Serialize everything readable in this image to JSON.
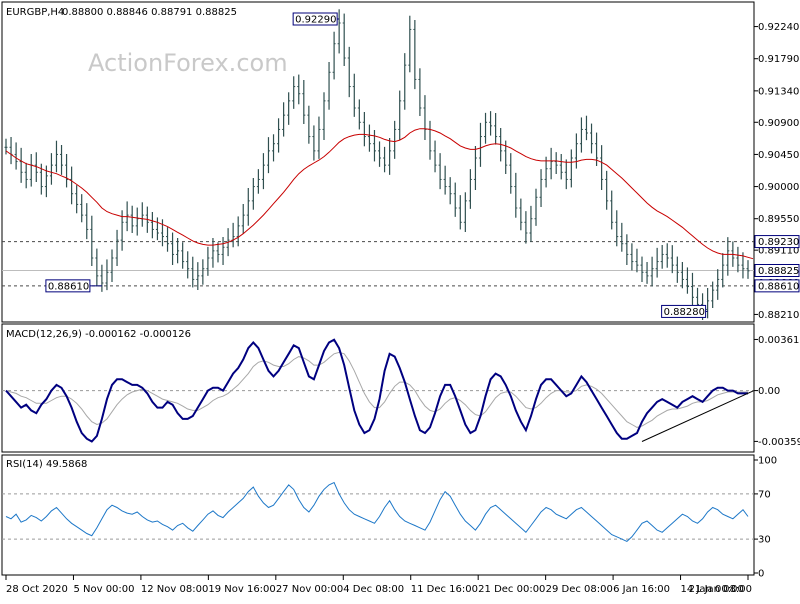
{
  "header": {
    "symbol": "EURGBP,H4",
    "ohlc": "0.88800 0.88846 0.88791 0.88825",
    "watermark": "ActionForex.com"
  },
  "colors": {
    "background": "#ffffff",
    "candles": "#2f4f4f",
    "ma": "#c80000",
    "macd": "#000080",
    "signal": "#a8a8a8",
    "rsi": "#1e78c8",
    "grid": "#6e6e6e",
    "label_box": "#00007a"
  },
  "chart_data": [
    {
      "type": "line",
      "title": "EURGBP,H4",
      "yaxis_ticks": [
        0.9224,
        0.9179,
        0.9134,
        0.909,
        0.9045,
        0.9,
        0.8955,
        0.8911,
        0.8866,
        0.8821
      ],
      "ylim": [
        0.8816,
        0.925
      ],
      "x_dates": [
        "28 Oct 2020",
        "5 Nov 00:00",
        "12 Nov 08:00",
        "19 Nov 16:00",
        "27 Nov 00:00",
        "4 Dec 08:00",
        "11 Dec 16:00",
        "21 Dec 00:00",
        "29 Dec 08:00",
        "6 Jan 16:00",
        "14 Jan 00:00",
        "21 Jan 08:00"
      ],
      "series": [
        {
          "kind": "price",
          "values": [
            0.9055,
            0.9045,
            0.9035,
            0.902,
            0.901,
            0.903,
            0.902,
            0.9,
            0.9015,
            0.903,
            0.9045,
            0.903,
            0.901,
            0.899,
            0.8975,
            0.896,
            0.894,
            0.89,
            0.8875,
            0.8865,
            0.888,
            0.89,
            0.8925,
            0.895,
            0.896,
            0.8945,
            0.8955,
            0.896,
            0.895,
            0.894,
            0.8935,
            0.893,
            0.892,
            0.8905,
            0.891,
            0.8895,
            0.8885,
            0.887,
            0.8875,
            0.8885,
            0.89,
            0.891,
            0.8905,
            0.8915,
            0.8925,
            0.893,
            0.8945,
            0.896,
            0.898,
            0.9,
            0.901,
            0.903,
            0.905,
            0.906,
            0.908,
            0.91,
            0.912,
            0.914,
            0.913,
            0.91,
            0.907,
            0.905,
            0.908,
            0.912,
            0.916,
            0.92,
            0.9229,
            0.918,
            0.914,
            0.911,
            0.909,
            0.907,
            0.906,
            0.905,
            0.904,
            0.903,
            0.905,
            0.908,
            0.912,
            0.917,
            0.922,
            0.915,
            0.911,
            0.908,
            0.905,
            0.903,
            0.901,
            0.9,
            0.899,
            0.897,
            0.895,
            0.898,
            0.901,
            0.904,
            0.907,
            0.909,
            0.9085,
            0.907,
            0.905,
            0.903,
            0.9,
            0.897,
            0.895,
            0.8935,
            0.8955,
            0.8985,
            0.901,
            0.9025,
            0.9035,
            0.903,
            0.902,
            0.901,
            0.904,
            0.906,
            0.908,
            0.9075,
            0.906,
            0.904,
            0.901,
            0.898,
            0.895,
            0.893,
            0.892,
            0.8905,
            0.8895,
            0.889,
            0.888,
            0.8875,
            0.8885,
            0.8895,
            0.8905,
            0.89,
            0.889,
            0.888,
            0.887,
            0.886,
            0.8845,
            0.8835,
            0.8828,
            0.884,
            0.8855,
            0.887,
            0.889,
            0.891,
            0.89,
            0.889,
            0.8885,
            0.8882
          ],
          "ma": [
            0.905,
            0.9045,
            0.904,
            0.9036,
            0.9032,
            0.903,
            0.9028,
            0.9025,
            0.9022,
            0.902,
            0.9018,
            0.9015,
            0.9012,
            0.9008,
            0.9003,
            0.8998,
            0.8992,
            0.8985,
            0.8978,
            0.897,
            0.8965,
            0.8962,
            0.896,
            0.8958,
            0.8958,
            0.8957,
            0.8956,
            0.8955,
            0.8954,
            0.8952,
            0.895,
            0.8947,
            0.8944,
            0.894,
            0.8936,
            0.8932,
            0.8928,
            0.8924,
            0.8921,
            0.8919,
            0.8918,
            0.8918,
            0.8919,
            0.892,
            0.8922,
            0.8925,
            0.8929,
            0.8934,
            0.894,
            0.8946,
            0.8953,
            0.896,
            0.8968,
            0.8976,
            0.8984,
            0.8992,
            0.9001,
            0.901,
            0.9018,
            0.9024,
            0.9029,
            0.9033,
            0.9037,
            0.9042,
            0.9048,
            0.9055,
            0.9062,
            0.9067,
            0.907,
            0.9072,
            0.9073,
            0.9073,
            0.9072,
            0.9071,
            0.9069,
            0.9066,
            0.9064,
            0.9063,
            0.9065,
            0.9069,
            0.9075,
            0.9079,
            0.9081,
            0.9081,
            0.908,
            0.9078,
            0.9075,
            0.9071,
            0.9067,
            0.9062,
            0.9057,
            0.9054,
            0.9052,
            0.9052,
            0.9054,
            0.9057,
            0.9059,
            0.906,
            0.9059,
            0.9057,
            0.9054,
            0.905,
            0.9046,
            0.9042,
            0.9039,
            0.9037,
            0.9036,
            0.9036,
            0.9036,
            0.9036,
            0.9035,
            0.9034,
            0.9034,
            0.9035,
            0.9037,
            0.9038,
            0.9038,
            0.9037,
            0.9034,
            0.903,
            0.9024,
            0.9018,
            0.9012,
            0.9005,
            0.8998,
            0.8991,
            0.8984,
            0.8977,
            0.8971,
            0.8966,
            0.8962,
            0.8958,
            0.8953,
            0.8948,
            0.8943,
            0.8937,
            0.8931,
            0.8925,
            0.8919,
            0.8914,
            0.891,
            0.8907,
            0.8905,
            0.8905,
            0.8905,
            0.8904,
            0.8903,
            0.8901,
            0.8899
          ]
        }
      ],
      "levels": [
        {
          "label": "0.89230",
          "value": 0.8923,
          "style": "dashed"
        },
        {
          "label": "0.88610",
          "value": 0.8861,
          "style": "dashed"
        },
        {
          "label": "0.88825",
          "value": 0.88825,
          "style": "solid"
        }
      ],
      "annotations": [
        {
          "text": "0.92290",
          "value": 0.9229
        },
        {
          "text": "0.88610",
          "value": 0.8861
        },
        {
          "text": "0.88280",
          "value": 0.8828
        }
      ]
    },
    {
      "type": "line",
      "title": "MACD(12,26,9) -0.000162 -0.000126",
      "yaxis_ticks": [
        "0.003615",
        "0.00",
        "-0.003592"
      ],
      "ylim": [
        -0.0042,
        0.004
      ],
      "series": [
        {
          "name": "MACD",
          "values": [
            0.0,
            -0.0004,
            -0.0008,
            -0.0012,
            -0.001,
            -0.0014,
            -0.0016,
            -0.001,
            -0.0006,
            0.0,
            0.0004,
            0.0002,
            -0.0004,
            -0.0012,
            -0.0022,
            -0.003,
            -0.0034,
            -0.0036,
            -0.0032,
            -0.002,
            -0.0006,
            0.0004,
            0.0008,
            0.0008,
            0.0006,
            0.0004,
            0.0004,
            0.0002,
            -0.0002,
            -0.0008,
            -0.0012,
            -0.0012,
            -0.0008,
            -0.001,
            -0.0016,
            -0.002,
            -0.002,
            -0.0018,
            -0.0012,
            -0.0006,
            0.0,
            0.0002,
            0.0002,
            0.0,
            0.0006,
            0.0012,
            0.0016,
            0.0022,
            0.003,
            0.0034,
            0.003,
            0.0022,
            0.0014,
            0.001,
            0.0014,
            0.002,
            0.0026,
            0.0032,
            0.003,
            0.002,
            0.001,
            0.0008,
            0.0018,
            0.0028,
            0.0034,
            0.0036,
            0.003,
            0.0018,
            0.0002,
            -0.0014,
            -0.0024,
            -0.003,
            -0.0028,
            -0.002,
            -0.0006,
            0.0014,
            0.0026,
            0.0024,
            0.0016,
            0.0006,
            -0.0006,
            -0.0018,
            -0.0028,
            -0.003,
            -0.0026,
            -0.0016,
            -0.0004,
            0.0004,
            0.0004,
            -0.0004,
            -0.0014,
            -0.0024,
            -0.003,
            -0.0028,
            -0.0018,
            -0.0004,
            0.0008,
            0.0012,
            0.001,
            0.0004,
            -0.0004,
            -0.0014,
            -0.0022,
            -0.0028,
            -0.0018,
            -0.0006,
            0.0004,
            0.0008,
            0.0008,
            0.0004,
            0.0,
            -0.0004,
            -0.0002,
            0.0004,
            0.001,
            0.0006,
            0.0,
            -0.0006,
            -0.0012,
            -0.0018,
            -0.0024,
            -0.003,
            -0.0034,
            -0.0034,
            -0.0032,
            -0.003,
            -0.0022,
            -0.0016,
            -0.0012,
            -0.0008,
            -0.0006,
            -0.0008,
            -0.001,
            -0.0012,
            -0.0008,
            -0.0006,
            -0.0004,
            -0.0006,
            -0.0008,
            -0.0004,
            0.0,
            0.0002,
            0.0002,
            0.0,
            0.0,
            -0.0002,
            -0.0002,
            -0.0002
          ]
        },
        {
          "name": "Signal",
          "values": [
            0.0,
            -0.0001,
            -0.0002,
            -0.0004,
            -0.0005,
            -0.0007,
            -0.0009,
            -0.0009,
            -0.0009,
            -0.0007,
            -0.0005,
            -0.0004,
            -0.0004,
            -0.0006,
            -0.0009,
            -0.0013,
            -0.0018,
            -0.0022,
            -0.0024,
            -0.0023,
            -0.002,
            -0.0015,
            -0.001,
            -0.0006,
            -0.0003,
            -0.0001,
            0.0,
            0.0001,
            0.0,
            -0.0002,
            -0.0004,
            -0.0006,
            -0.0007,
            -0.0008,
            -0.0009,
            -0.0011,
            -0.0013,
            -0.0014,
            -0.0014,
            -0.0012,
            -0.001,
            -0.0007,
            -0.0005,
            -0.0004,
            -0.0002,
            0.0001,
            0.0004,
            0.0008,
            0.0012,
            0.0017,
            0.002,
            0.0021,
            0.002,
            0.0018,
            0.0017,
            0.0017,
            0.0019,
            0.0022,
            0.0024,
            0.0023,
            0.0021,
            0.0018,
            0.0018,
            0.002,
            0.0023,
            0.0026,
            0.0027,
            0.0026,
            0.0021,
            0.0014,
            0.0006,
            -0.0002,
            -0.0008,
            -0.0012,
            -0.0012,
            -0.0008,
            -0.0002,
            0.0003,
            0.0006,
            0.0006,
            0.0004,
            0.0,
            -0.0006,
            -0.0011,
            -0.0014,
            -0.0015,
            -0.0013,
            -0.0009,
            -0.0006,
            -0.0005,
            -0.0007,
            -0.001,
            -0.0014,
            -0.0017,
            -0.0018,
            -0.0015,
            -0.001,
            -0.0005,
            -0.0002,
            -0.0001,
            -0.0001,
            -0.0004,
            -0.0008,
            -0.0012,
            -0.0013,
            -0.0012,
            -0.0009,
            -0.0005,
            -0.0002,
            0.0,
            0.0,
            -0.0001,
            -0.0001,
            0.0,
            0.0003,
            0.0004,
            0.0003,
            0.0001,
            -0.0002,
            -0.0006,
            -0.001,
            -0.0014,
            -0.0018,
            -0.0022,
            -0.0024,
            -0.0026,
            -0.0025,
            -0.0023,
            -0.0021,
            -0.0018,
            -0.0016,
            -0.0014,
            -0.0013,
            -0.0013,
            -0.0012,
            -0.0011,
            -0.0009,
            -0.0008,
            -0.0008,
            -0.0007,
            -0.0005,
            -0.0003,
            -0.0002,
            -0.0001,
            -0.0001,
            -0.0001,
            -0.0001,
            -0.0001
          ]
        }
      ],
      "trendline": {
        "from": [
          126,
          -0.0036
        ],
        "to": [
          151,
          0.0
        ]
      }
    },
    {
      "type": "line",
      "title": "RSI(14) 49.5868",
      "yaxis_ticks": [
        "100",
        "70",
        "30",
        "0"
      ],
      "ylim": [
        0,
        100
      ],
      "levels": [
        70,
        30
      ],
      "series": [
        {
          "name": "RSI",
          "values": [
            50,
            48,
            52,
            45,
            47,
            51,
            49,
            46,
            50,
            55,
            58,
            53,
            48,
            44,
            41,
            38,
            35,
            33,
            40,
            48,
            56,
            60,
            58,
            55,
            53,
            52,
            54,
            50,
            47,
            45,
            46,
            43,
            41,
            38,
            42,
            44,
            40,
            37,
            42,
            47,
            52,
            55,
            51,
            49,
            54,
            58,
            62,
            66,
            72,
            76,
            68,
            62,
            58,
            60,
            66,
            72,
            78,
            74,
            65,
            58,
            54,
            60,
            68,
            74,
            78,
            80,
            70,
            62,
            56,
            52,
            50,
            48,
            46,
            44,
            50,
            58,
            64,
            56,
            50,
            46,
            44,
            42,
            40,
            38,
            45,
            55,
            65,
            72,
            68,
            60,
            52,
            46,
            42,
            38,
            44,
            52,
            58,
            60,
            56,
            52,
            48,
            44,
            40,
            36,
            42,
            48,
            54,
            58,
            56,
            52,
            50,
            48,
            52,
            56,
            58,
            54,
            50,
            46,
            42,
            38,
            34,
            32,
            30,
            28,
            32,
            38,
            44,
            46,
            42,
            38,
            36,
            40,
            44,
            48,
            52,
            50,
            46,
            44,
            48,
            54,
            58,
            56,
            52,
            50,
            48,
            52,
            56,
            50
          ]
        }
      ]
    }
  ]
}
